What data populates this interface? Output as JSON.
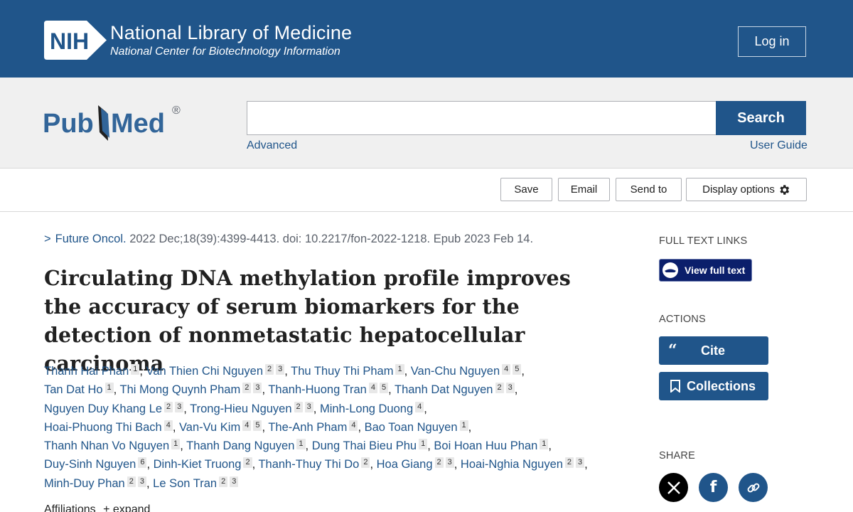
{
  "nih": {
    "logo_text": "NIH",
    "title": "National Library of Medicine",
    "subtitle": "National Center for Biotechnology Information",
    "login_label": "Log in"
  },
  "search": {
    "value": "",
    "button_label": "Search",
    "advanced_label": "Advanced",
    "user_guide_label": "User Guide"
  },
  "toolbar": {
    "save_label": "Save",
    "email_label": "Email",
    "send_to_label": "Send to",
    "display_options_label": "Display options"
  },
  "article": {
    "journal": "Future Oncol.",
    "citation_rest": "2022 Dec;18(39):4399-4413. doi: 10.2217/fon-2022-1218. Epub 2023 Feb 14.",
    "title": "Circulating DNA methylation profile improves the accuracy of serum biomarkers for the detection of nonmetastatic hepatocellular carcinoma",
    "authors": [
      {
        "name": "Thanh Hai Phan",
        "affs": [
          "1"
        ]
      },
      {
        "name": "Van Thien Chi Nguyen",
        "affs": [
          "2",
          "3"
        ]
      },
      {
        "name": "Thu Thuy Thi Pham",
        "affs": [
          "1"
        ]
      },
      {
        "name": "Van-Chu Nguyen",
        "affs": [
          "4",
          "5"
        ]
      },
      {
        "name": "Tan Dat Ho",
        "affs": [
          "1"
        ]
      },
      {
        "name": "Thi Mong Quynh Pham",
        "affs": [
          "2",
          "3"
        ]
      },
      {
        "name": "Thanh-Huong Tran",
        "affs": [
          "4",
          "5"
        ]
      },
      {
        "name": "Thanh Dat Nguyen",
        "affs": [
          "2",
          "3"
        ]
      },
      {
        "name": "Nguyen Duy Khang Le",
        "affs": [
          "2",
          "3"
        ]
      },
      {
        "name": "Trong-Hieu Nguyen",
        "affs": [
          "2",
          "3"
        ]
      },
      {
        "name": "Minh-Long Duong",
        "affs": [
          "4"
        ]
      },
      {
        "name": "Hoai-Phuong Thi Bach",
        "affs": [
          "4"
        ]
      },
      {
        "name": "Van-Vu Kim",
        "affs": [
          "4",
          "5"
        ]
      },
      {
        "name": "The-Anh Pham",
        "affs": [
          "4"
        ]
      },
      {
        "name": "Bao Toan Nguyen",
        "affs": [
          "1"
        ]
      },
      {
        "name": "Thanh Nhan Vo Nguyen",
        "affs": [
          "1"
        ]
      },
      {
        "name": "Thanh Dang Nguyen",
        "affs": [
          "1"
        ]
      },
      {
        "name": "Dung Thai Bieu Phu",
        "affs": [
          "1"
        ]
      },
      {
        "name": "Boi Hoan Huu Phan",
        "affs": [
          "1"
        ]
      },
      {
        "name": "Duy-Sinh Nguyen",
        "affs": [
          "6"
        ]
      },
      {
        "name": "Dinh-Kiet Truong",
        "affs": [
          "2"
        ]
      },
      {
        "name": "Thanh-Thuy Thi Do",
        "affs": [
          "2"
        ]
      },
      {
        "name": "Hoa Giang",
        "affs": [
          "2",
          "3"
        ]
      },
      {
        "name": "Hoai-Nghia Nguyen",
        "affs": [
          "2",
          "3"
        ]
      },
      {
        "name": "Minh-Duy Phan",
        "affs": [
          "2",
          "3"
        ]
      },
      {
        "name": "Le Son Tran",
        "affs": [
          "2",
          "3"
        ]
      }
    ],
    "author_line_breaks_after": [
      3,
      7,
      10,
      14,
      18,
      23
    ],
    "affiliations_label": "Affiliations",
    "expand_label": "expand"
  },
  "sidebar": {
    "full_text_links_heading": "FULL TEXT LINKS",
    "view_full_text_label": "View full text",
    "actions_heading": "ACTIONS",
    "cite_label": "Cite",
    "collections_label": "Collections",
    "share_heading": "SHARE"
  },
  "colors": {
    "nih_blue": "#20558a",
    "link_blue": "#20558a",
    "full_text_navy": "#0b1f6b"
  },
  "icons": {
    "nih_logo": "nih-logo",
    "pubmed_logo": "pubmed-logo",
    "gear": "gear-icon",
    "chevron": "chevron-right-icon",
    "quote": "quote-icon",
    "bookmark": "bookmark-icon",
    "x": "x-share-icon",
    "facebook": "facebook-share-icon",
    "link": "link-share-icon"
  }
}
